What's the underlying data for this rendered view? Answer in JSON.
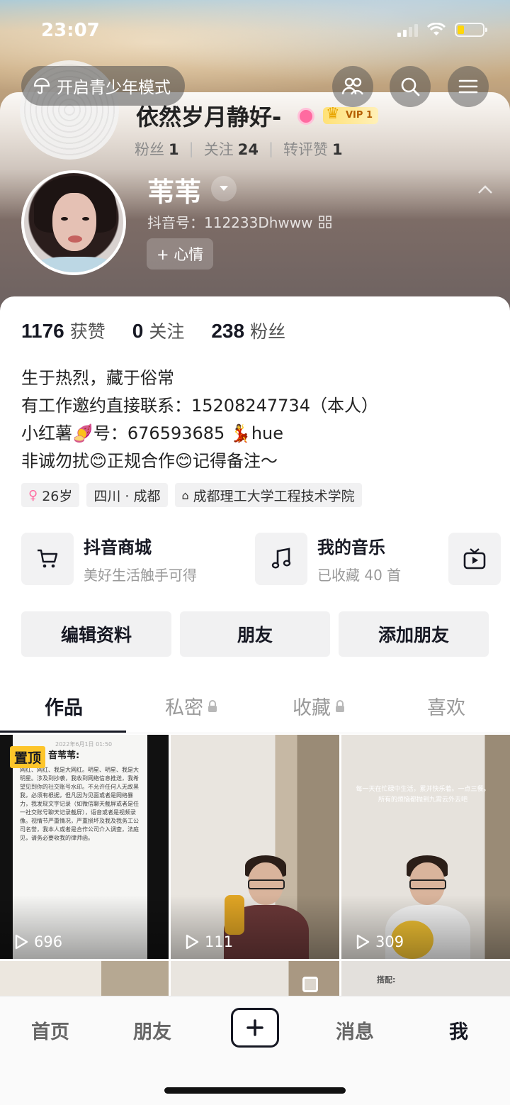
{
  "status": {
    "time": "23:07"
  },
  "top": {
    "youth_mode": "开启青少年模式"
  },
  "ghost": {
    "name": "依然岁月静好-",
    "vip": "VIP 1",
    "fans_label": "粉丝",
    "fans": "1",
    "follow_label": "关注",
    "follow": "24",
    "repost_label": "转评赞",
    "repost": "1"
  },
  "profile": {
    "nickname": "苇苇",
    "douyin_id": "抖音号：112233Dhwww",
    "mood_button": "+ 心情"
  },
  "stats": {
    "likes": "1176",
    "likes_label": "获赞",
    "following": "0",
    "following_label": "关注",
    "fans": "238",
    "fans_label": "粉丝"
  },
  "bio": [
    "生于热烈，藏于俗常",
    "有工作邀约直接联系：15208247734（本人）",
    "小红薯🍠号：676593685 💃hue",
    "非诚勿扰😊正规合作😊记得备注～"
  ],
  "tags": [
    "26岁",
    "四川 · 成都",
    "成都理工大学工程技术学院"
  ],
  "services": [
    {
      "title": "抖音商城",
      "subtitle": "美好生活触手可得",
      "icon": "cart-icon"
    },
    {
      "title": "我的音乐",
      "subtitle": "已收藏 40 首",
      "icon": "music-note-icon"
    }
  ],
  "actions": [
    "编辑资料",
    "朋友",
    "添加朋友"
  ],
  "tabs": [
    "作品",
    "私密",
    "收藏",
    "喜欢"
  ],
  "videos": [
    {
      "plays": "696",
      "pinned": "置顶",
      "title": "音苇苇:",
      "date": "2022年6月1日 01:50",
      "text": "网红、网红、我是大网红。明星、明星、我是大明星。涉及到抄袭，我收到网络信息推送，我希望见到你的社交账号水印。不允许任何人无故黑我，必须有根据，但凡因为见面或者是网络暴力，我发现文字记录（如微信聊天截屏或者是任一社交账号聊天记录截屏），语音或者是视频录像。视情节严重情况，严重损坏及我及我务工公司名誉，我本人或者是合作公司介入调查，法庭见，请务必要收我的律师函。"
    },
    {
      "plays": "111"
    },
    {
      "plays": "309",
      "text": "每一天在忙碌中生活，累并快乐着。一点三餐，所有的烦恼都抛到九霄云外去吧"
    }
  ],
  "second_row": {
    "label": "搭配:"
  },
  "nav": [
    "首页",
    "朋友",
    "消息",
    "我"
  ],
  "colors": {
    "accent_pink": "#ff6aa0",
    "pin_yellow": "#fdc52a",
    "vip_gold": "#ffe177"
  }
}
